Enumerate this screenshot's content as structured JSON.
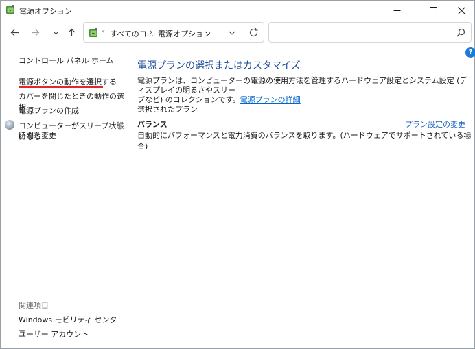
{
  "window": {
    "title": "電源オプション"
  },
  "address_bar": {
    "crumb_1": "すべてのコ...",
    "crumb_2": "電源オプション",
    "crumb_sep_1": "«",
    "crumb_sep_2": "›"
  },
  "sidebar": {
    "home": "コントロール パネル ホーム",
    "links": [
      "電源ボタンの動作を選択する",
      "カバーを閉じたときの動作の選択",
      "電源プランの作成",
      "コンピューターがスリープ状態になる",
      "時間を変更"
    ],
    "related_heading": "関連項目",
    "related_links": [
      "Windows モビリティ センター",
      "ユーザー アカウント"
    ]
  },
  "main": {
    "title": "電源プランの選択またはカスタマイズ",
    "desc_line1": "電源プランは、コンピューターの電源の使用方法を管理するハードウェア設定とシステム設定 (ディスプレイの明るさやスリー",
    "desc_line2": "プなど) のコレクションです。",
    "desc_link": "電源プランの詳細",
    "selected_plan_label": "選択されたプラン",
    "plan": {
      "name": "バランス",
      "change_link": "プラン設定の変更",
      "description": "自動的にパフォーマンスと電力消費のバランスを取ります。(ハードウェアでサポートされている場合)"
    },
    "help_icon_glyph": "?"
  },
  "colors": {
    "title_blue": "#1e4e9c",
    "link_blue": "#0066cc",
    "underline_red": "#e3262b",
    "help_blue": "#1c7ad6"
  },
  "icons": {
    "window": "power-options-icon",
    "minimize": "minimize-icon",
    "maximize": "maximize-icon",
    "close": "close-icon",
    "back": "arrow-left-icon",
    "forward": "arrow-right-icon",
    "recent": "chevron-down-icon",
    "up": "arrow-up-icon",
    "refresh": "refresh-icon",
    "search": "search-icon",
    "help": "help-icon",
    "sleep": "sleep-moon-icon"
  }
}
